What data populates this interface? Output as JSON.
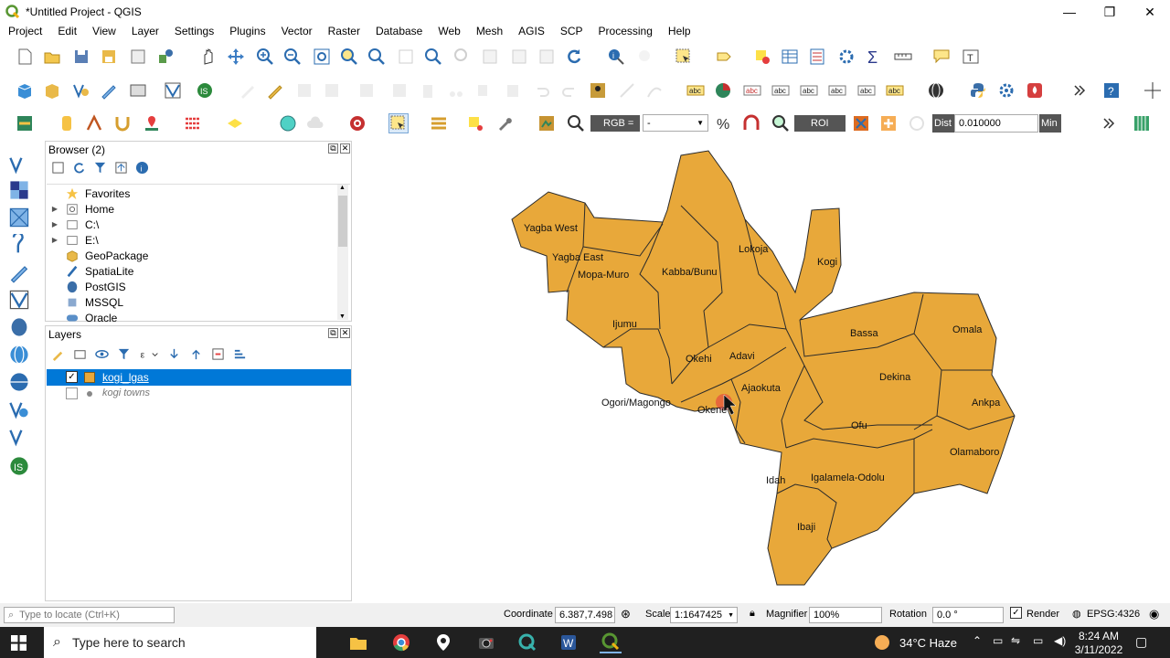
{
  "window": {
    "title": "*Untitled Project - QGIS",
    "minimize": "—",
    "restore": "❐",
    "close": "✕"
  },
  "menu": [
    "Project",
    "Edit",
    "View",
    "Layer",
    "Settings",
    "Plugins",
    "Vector",
    "Raster",
    "Database",
    "Web",
    "Mesh",
    "AGIS",
    "SCP",
    "Processing",
    "Help"
  ],
  "raster_toolbar": {
    "rgb_label": "RGB =",
    "rgb_value": "-",
    "roi_label": "ROI",
    "dist_label": "Dist",
    "dist_value": "0.010000",
    "min_label": "Min"
  },
  "browser": {
    "title": "Browser (2)",
    "items": [
      {
        "label": "Favorites",
        "icon": "star-icon",
        "expandable": false
      },
      {
        "label": "Home",
        "icon": "home-folder-icon",
        "expandable": true
      },
      {
        "label": "C:\\",
        "icon": "folder-icon",
        "expandable": true
      },
      {
        "label": "E:\\",
        "icon": "folder-icon",
        "expandable": true
      },
      {
        "label": "GeoPackage",
        "icon": "geopackage-icon",
        "expandable": false
      },
      {
        "label": "SpatiaLite",
        "icon": "spatialite-icon",
        "expandable": false
      },
      {
        "label": "PostGIS",
        "icon": "postgis-icon",
        "expandable": false
      },
      {
        "label": "MSSQL",
        "icon": "mssql-icon",
        "expandable": false
      },
      {
        "label": "Oracle",
        "icon": "oracle-icon",
        "expandable": false
      }
    ]
  },
  "layers": {
    "title": "Layers",
    "items": [
      {
        "label": "kogi_lgas",
        "checked": true,
        "selected": true
      },
      {
        "label": "kogi towns",
        "checked": false,
        "selected": false
      }
    ]
  },
  "map": {
    "fill_color": "#E8A83A",
    "stroke_color": "#2a2a2a",
    "labels": [
      "Yagba West",
      "Yagba East",
      "Mopa-Muro",
      "Kabba/Bunu",
      "Lokoja",
      "Kogi",
      "Ijumu",
      "Okehi",
      "Adavi",
      "Ajaokuta",
      "Ogori/Magongo",
      "Okene",
      "Bassa",
      "Omala",
      "Dekina",
      "Ankpa",
      "Ofu",
      "Olamaboro",
      "Idah",
      "Igalamela-Odolu",
      "Ibaji"
    ]
  },
  "status": {
    "locate_placeholder": "Type to locate (Ctrl+K)",
    "coordinate_label": "Coordinate",
    "coordinate_value": "6.387,7.498",
    "scale_label": "Scale",
    "scale_value": "1:1647425",
    "magnifier_label": "Magnifier",
    "magnifier_value": "100%",
    "rotation_label": "Rotation",
    "rotation_value": "0.0 °",
    "render_label": "Render",
    "crs": "EPSG:4326"
  },
  "taskbar": {
    "search_placeholder": "Type here to search",
    "weather": "34°C Haze",
    "time": "8:24 AM",
    "date": "3/11/2022"
  }
}
